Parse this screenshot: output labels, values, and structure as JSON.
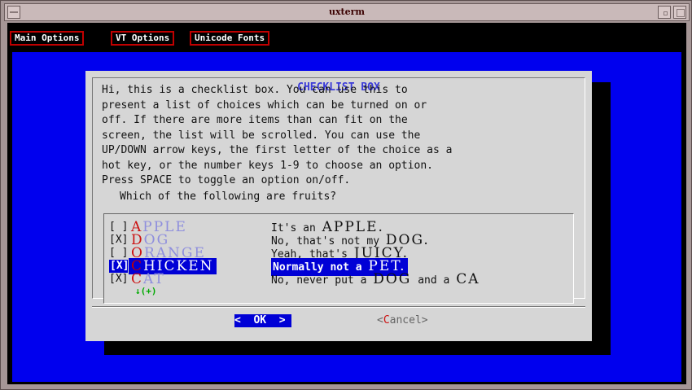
{
  "window": {
    "title": "uxterm"
  },
  "menubar": {
    "items": [
      "Main Options",
      "VT Options",
      "Unicode Fonts"
    ]
  },
  "dialog": {
    "title": "CHECKLIST BOX",
    "description": "Hi, this is a checklist box. You can use this to\npresent a list of choices which can be turned on or\noff. If there are more items than can fit on the\nscreen, the list will be scrolled. You can use the\nUP/DOWN arrow keys, the first letter of the choice as a\nhot key, or the number keys 1-9 to choose an option.\nPress SPACE to toggle an option on/off.",
    "question": "Which of the following are fruits?",
    "items": [
      {
        "checkbox": "[ ]",
        "hotkey": "A",
        "tag_rest": "PPLE",
        "desc_pre": "It's an ",
        "desc_big": "APPLE.",
        "checked": false,
        "selected": false
      },
      {
        "checkbox": "[X]",
        "hotkey": "D",
        "tag_rest": "OG",
        "desc_pre": "No, that's not my ",
        "desc_big": "DOG.",
        "checked": true,
        "selected": false
      },
      {
        "checkbox": "[ ]",
        "hotkey": "O",
        "tag_rest": "RANGE",
        "desc_pre": "Yeah, that's ",
        "desc_big": "JUICY.",
        "checked": false,
        "selected": false
      },
      {
        "checkbox": "[X]",
        "hotkey": "C",
        "tag_rest": "HICKEN",
        "desc_pre": "Normally not a ",
        "desc_big": "PET.",
        "checked": true,
        "selected": true
      },
      {
        "checkbox": "[X]",
        "hotkey": "C",
        "tag_rest": "AT",
        "desc_pre": "No, never put a ",
        "desc_big": "DOG",
        "desc_post": " and a ",
        "desc_big2": "CA",
        "checked": true,
        "selected": false
      }
    ],
    "more_indicator": "↓(+)",
    "buttons": {
      "ok": "<  OK  >",
      "cancel_open": "<",
      "cancel_hotkey": "C",
      "cancel_rest": "ancel>"
    }
  },
  "colors": {
    "background_blue": "#0000ee",
    "selection": "#0000d6",
    "hotkey_red": "#cc1010",
    "tag_blue": "#8f8fdd",
    "menu_border": "#c00000",
    "more_green": "#00aa00"
  }
}
